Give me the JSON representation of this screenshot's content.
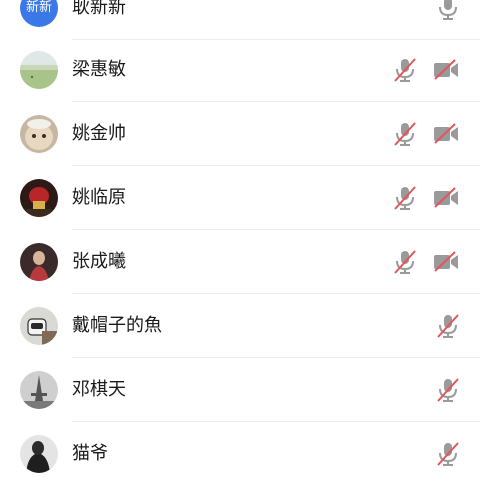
{
  "participants": [
    {
      "name": "耿新新",
      "avatar_text": "新新",
      "mic": "on",
      "cam": "none",
      "avatar_color": "#3b78e7"
    },
    {
      "name": "梁惠敏",
      "mic": "muted",
      "cam": "off"
    },
    {
      "name": "姚金帅",
      "mic": "muted",
      "cam": "off"
    },
    {
      "name": "姚临原",
      "mic": "muted",
      "cam": "off"
    },
    {
      "name": "张成曦",
      "mic": "muted",
      "cam": "off"
    },
    {
      "name": "戴帽子的魚",
      "mic": "muted",
      "cam": "none"
    },
    {
      "name": "邓棋天",
      "mic": "muted",
      "cam": "none"
    },
    {
      "name": "猫爷",
      "mic": "muted",
      "cam": "none"
    }
  ],
  "colors": {
    "icon_gray": "#9a9a9a",
    "muted_red": "#e0565b",
    "separator": "#ececec",
    "avatar_blue": "#3b78e7"
  }
}
